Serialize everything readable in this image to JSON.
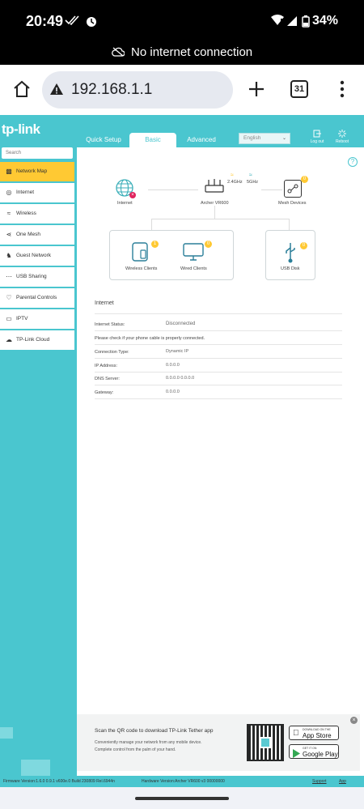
{
  "status": {
    "time": "20:49",
    "battery": "34%"
  },
  "notice": "No internet connection",
  "browser": {
    "url": "192.168.1.1",
    "tabs_count": "31"
  },
  "router": {
    "logo": "tp-link",
    "tabs": [
      "Quick Setup",
      "Basic",
      "Advanced"
    ],
    "language": "English",
    "logout": "Log out",
    "reboot": "Reboot",
    "search_placeholder": "Search",
    "sidebar": [
      {
        "label": "Network Map",
        "icon": "network-map-icon"
      },
      {
        "label": "Internet",
        "icon": "globe-icon"
      },
      {
        "label": "Wireless",
        "icon": "wifi-icon"
      },
      {
        "label": "One Mesh",
        "icon": "mesh-icon"
      },
      {
        "label": "Guest Network",
        "icon": "guest-icon"
      },
      {
        "label": "USB Sharing",
        "icon": "usb-icon"
      },
      {
        "label": "Parental Controls",
        "icon": "heart-icon"
      },
      {
        "label": "IPTV",
        "icon": "tv-icon"
      },
      {
        "label": "TP-Link Cloud",
        "icon": "cloud-icon"
      }
    ],
    "map": {
      "internet": "Internet",
      "router": "Archer VR600",
      "band1": "2.4GHz",
      "band2": "5GHz",
      "mesh": "Mesh Devices",
      "mesh_count": "0",
      "wireless_clients": "Wireless Clients",
      "wireless_count": "1",
      "wired_clients": "Wired Clients",
      "wired_count": "0",
      "usb": "USB Disk",
      "usb_count": "0"
    },
    "details": {
      "section": "Internet",
      "status_label": "Internet Status:",
      "status_value": "Disconnected",
      "hint": "Please check if your phone cable is properly connected.",
      "conn_label": "Connection Type:",
      "conn_value": "Dynamic IP",
      "ip_label": "IP Address:",
      "ip_value": "0.0.0.0",
      "dns_label": "DNS Server:",
      "dns_value": "0.0.0.0 0.0.0.0",
      "gw_label": "Gateway:",
      "gw_value": "0.0.0.0"
    },
    "tether": {
      "title": "Scan the QR code to download TP-Link Tether app",
      "desc1": "Conveniently manage your network from any mobile device.",
      "desc2": "Complete control from the palm of your hand.",
      "appstore_small": "DOWNLOAD ON THE",
      "appstore_big": "App Store",
      "gplay_small": "GET IT ON",
      "gplay_big": "Google Play"
    },
    "footer": {
      "firmware": "Firmware Version:1.6.0 0.9.1 v600e.0 Build 230809 Rel.6944n",
      "hardware": "Hardware Version:Archer VR600 v3 00000000",
      "support": "Support",
      "app": "App"
    }
  }
}
